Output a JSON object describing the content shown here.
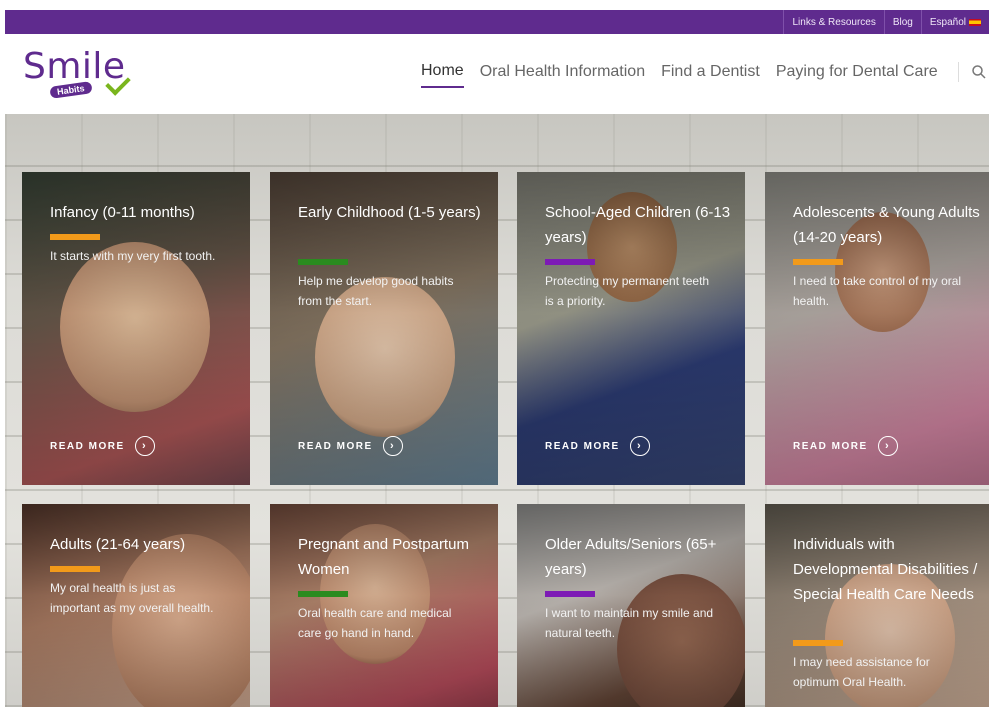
{
  "topbar": {
    "links": [
      "Links & Resources",
      "Blog",
      "Español"
    ]
  },
  "logo": {
    "word": "Smile",
    "sub": "Habits"
  },
  "nav": {
    "items": [
      "Home",
      "Oral Health Information",
      "Find a Dentist",
      "Paying for Dental Care"
    ],
    "active": "Home",
    "search_icon": "search-icon"
  },
  "colors": {
    "purple": "#5f2b8e",
    "orange": "#f29a1a",
    "green": "#2a8b1f",
    "violet": "#7d1bb5"
  },
  "cards": [
    {
      "title": "Infancy (0-11 months)",
      "text": "It starts with my very first tooth.",
      "read_more": "READ MORE",
      "accent": "#f29a1a"
    },
    {
      "title": "Early Childhood (1-5 years)",
      "text": "Help me develop good habits from the start.",
      "read_more": "READ MORE",
      "accent": "#2a8b1f"
    },
    {
      "title": "School-Aged Children (6-13 years)",
      "text": "Protecting my permanent teeth is a priority.",
      "read_more": "READ MORE",
      "accent": "#7d1bb5"
    },
    {
      "title": "Adolescents & Young Adults (14-20 years)",
      "text": "I need to take control of my oral health.",
      "read_more": "READ MORE",
      "accent": "#f29a1a"
    },
    {
      "title": "Adults (21-64 years)",
      "text": "My oral health is just as important as my overall health.",
      "read_more": "",
      "accent": "#f29a1a"
    },
    {
      "title": "Pregnant and Postpartum Women",
      "text": "Oral health care and medical care go hand in hand.",
      "read_more": "",
      "accent": "#2a8b1f"
    },
    {
      "title": "Older Adults/Seniors (65+ years)",
      "text": "I want to maintain my smile and natural teeth.",
      "read_more": "",
      "accent": "#7d1bb5"
    },
    {
      "title": "Individuals with Developmental Disabilities / Special Health Care Needs",
      "text": "I may need assistance for optimum Oral Health.",
      "read_more": "",
      "accent": "#f29a1a"
    }
  ]
}
